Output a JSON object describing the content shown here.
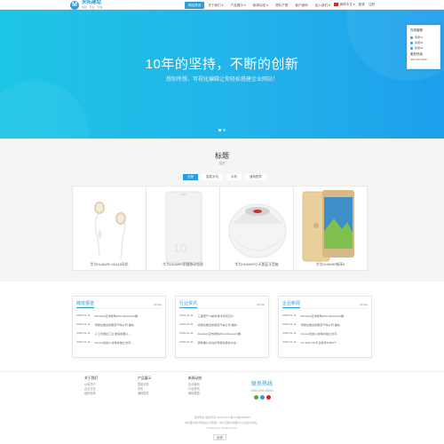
{
  "brand": {
    "name": "米拓建站",
    "slogan": "成就 · 专业 · 可信",
    "accent": "#2b9ed9"
  },
  "nav": {
    "items": [
      "网站首页",
      "关于我们 ▾",
      "产品展示 ▾",
      "新闻动态 ▾",
      "资料下载",
      "客户案例",
      "加入我们 ▾"
    ],
    "lang": "简体中文 ▾",
    "login": "登录",
    "register": "注册"
  },
  "hero": {
    "title": "10年的坚持，不断的创新",
    "subtitle": "想你所想，可视化编辑让你轻松搭建企业网站！",
    "gradient": [
      "#1ec6e6",
      "#1e9fec"
    ]
  },
  "side_panel": {
    "title": "在线客服",
    "rows": [
      "客服01",
      "客服02",
      "客服03"
    ],
    "phone_label": "服务热线",
    "phone": "400-000-0000"
  },
  "products": {
    "title": "标题",
    "subtitle": "描述",
    "tabs": [
      "全部",
      "智能手机",
      "手机",
      "通用配件"
    ],
    "cards": [
      {
        "caption": "华为HUAWEI AM116耳机"
      },
      {
        "caption": "华为HUAWEI荣耀移动电源"
      },
      {
        "caption": "华为HUAWEI小天鹅蓝牙音箱"
      },
      {
        "caption": "华为HUAWEI畅享6"
      }
    ]
  },
  "news": {
    "more": "MORE",
    "boxes": [
      {
        "title": "媒体报道",
        "items": [
          {
            "date": "2018-01-11",
            "text": "Parallels宣布收购2014 Macworld展..."
          },
          {
            "date": "2018-01-11",
            "text": "特斯拉推出新能源汽车公司 撬动..."
          },
          {
            "date": "2018-01-11",
            "text": "人工智能和工业 推进机器人..."
          },
          {
            "date": "2018-01-11",
            "text": "Oculus创始人将举办独立访问..."
          }
        ]
      },
      {
        "title": "行业资讯",
        "items": [
          {
            "date": "2018-01-11",
            "text": "三星量产10纳米技术手机芯片..."
          },
          {
            "date": "2018-01-11",
            "text": "特斯拉推出新能源汽车公司 撬动..."
          },
          {
            "date": "2018-01-11",
            "text": "Parallels宣布收购2014 Macworld展..."
          },
          {
            "date": "2018-01-11",
            "text": "微软确认将在世界移动通信大会..."
          }
        ]
      },
      {
        "title": "企业新闻",
        "items": [
          {
            "date": "2018-01-11",
            "text": "Parallels宣布收购2014 Macworld展..."
          },
          {
            "date": "2018-01-11",
            "text": "特斯拉推出新能源汽车公司 撬动..."
          },
          {
            "date": "2018-01-11",
            "text": "Oculus创始人将举办独立访问..."
          },
          {
            "date": "2018-01-11",
            "text": "LG Web OS平台新增11000个..."
          }
        ]
      }
    ]
  },
  "footer": {
    "cols": [
      {
        "head": "关于我们",
        "items": [
          "公司简介",
          "企业文化",
          "组织结构"
        ]
      },
      {
        "head": "产品展示",
        "items": [
          "智能手机",
          "手机",
          "通用配件"
        ]
      },
      {
        "head": "新闻动态",
        "items": [
          "企业新闻",
          "行业资讯",
          "媒体报道"
        ]
      }
    ],
    "hotline_title": "联系热线",
    "hotline": "400-000-0000",
    "copy1": "我的网站 版权所有 2008-2018 湘ICP备8888888",
    "copy2": "本页面内容为网站演示数据，前台页面内容都可以在后台修改。",
    "copy3": "Powered by MetInfo 6.0.0",
    "feedback": "反馈"
  }
}
